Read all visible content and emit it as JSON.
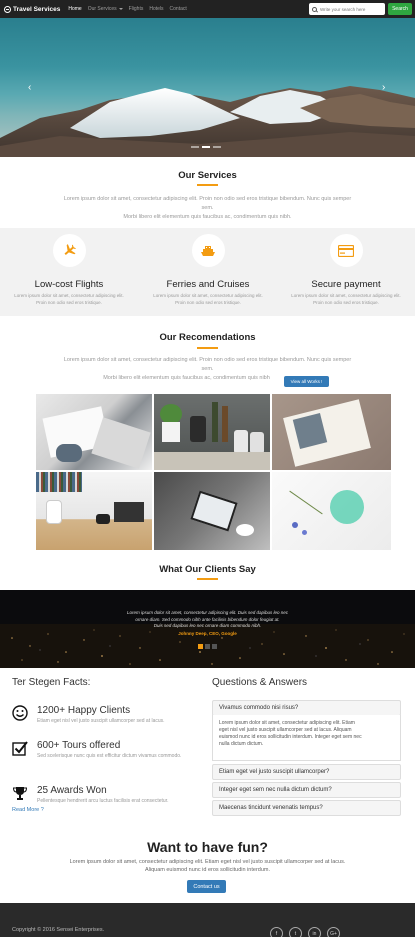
{
  "navbar": {
    "brand": "Travel Services",
    "items": [
      {
        "label": "Home",
        "active": true
      },
      {
        "label": "Our Services",
        "dropdown": true
      },
      {
        "label": "Flights"
      },
      {
        "label": "Hotels"
      },
      {
        "label": "Contact"
      }
    ],
    "search_placeholder": "Write your search here",
    "search_button": "Search"
  },
  "hero": {
    "prev_icon": "chevron-left-icon",
    "next_icon": "chevron-right-icon",
    "slides": 3,
    "active_slide": 2
  },
  "services": {
    "title": "Our Services",
    "text_line1": "Lorem ipsum dolor sit amet, consectetur adipiscing elit. Proin non odio sed eros tristique bibendum. Nunc quis semper",
    "text_line2": "sem.",
    "text_line3": "Morbi libero elit elementum quis faucibus ac, condimentum quis nibh.",
    "features": [
      {
        "icon": "airplane-icon",
        "title": "Low-cost Flights",
        "text1": "Lorem ipsum dolor sit amet, consectetur adipiscing elit.",
        "text2": "Proin non odio sed eros tristique."
      },
      {
        "icon": "ship-icon",
        "title": "Ferries and Cruises",
        "text1": "Lorem ipsum dolor sit amet, consectetur adipiscing elit.",
        "text2": "Proin non odio sed eros tristique."
      },
      {
        "icon": "credit-card-icon",
        "title": "Secure payment",
        "text1": "Lorem ipsum dolor sit amet, consectetur adipiscing elit.",
        "text2": "Proin non odio sed eros tristique."
      }
    ]
  },
  "recommendations": {
    "title": "Our Recomendations",
    "text_line1": "Lorem ipsum dolor sit amet, consectetur adipiscing elit. Proin non odio sed eros tristique bibendum. Nunc quis semper",
    "text_line2": "sem.",
    "text_line3": "Morbi libero elit elementum quis faucibus ac, condimentum quis nibh",
    "button": "View all Works !"
  },
  "clients": {
    "title": "What Our Clients Say",
    "quote_line1": "Lorem ipsum dolor sit amet, consectetur adipiscing elit. Duis sed dapibus leo nec",
    "quote_line2": "ornare diam. Sed commodo nibh ante facilisis bibendum dolor feugiat at.",
    "quote_line3": "Duis sed dapibus leo nec ornare diam commodo nibh.",
    "author": "Johnny Deep, CEO, Google",
    "slides": 3,
    "active_slide": 1
  },
  "facts": {
    "title": "Ter Stegen Facts:",
    "items": [
      {
        "icon": "smiley-icon",
        "title": "1200+ Happy Clients",
        "text": "Etiam eget nisl vel justo suscipit ullamcorper sed at lacus."
      },
      {
        "icon": "checkbox-icon",
        "title": "600+ Tours offered",
        "text": "Sed scelerisque nunc quis est efficitur dictum vivamus commodo."
      },
      {
        "icon": "trophy-icon",
        "title": "25 Awards Won",
        "text": "Pellentesque hendrerit arcu luctus facilisis erat consectetur."
      }
    ],
    "read_more": "Read More ?"
  },
  "qa": {
    "title": "Questions & Answers",
    "items": [
      {
        "question": "Vivamus commodo nisi risus?"
      },
      {
        "question": "Etiam eget vel justo suscipit ullamcorper?"
      },
      {
        "question": "Integer eget sem nec nulla dictum dictum?"
      },
      {
        "question": "Maecenas tincidunt venenatis tempus?"
      }
    ],
    "answer_line1": "Lorem ipsum dolor sit amet, consectetur adipiscing elit. Etiam",
    "answer_line2": "eget nisl vel justo suscipit ullamcorper sed at lacus. Aliquam",
    "answer_line3": "euismod nunc id eros sollicitudin interdum. Integer eget sem nec",
    "answer_line4": "nulla dictum dictum."
  },
  "cta": {
    "title": "Want to have fun?",
    "text_line1": "Lorem ipsum dolor sit amet, consectetur adipiscing elit. Etiam eget nisl vel justo suscipit ullamcorper sed at lacus.",
    "text_line2": "Aliquam euismod nunc id eros sollicitudin interdum.",
    "button": "Contact us"
  },
  "footer": {
    "copyright": "Copyright © 2016 Sensei Enterprises.",
    "socials": [
      {
        "icon": "facebook-icon",
        "glyph": "f"
      },
      {
        "icon": "twitter-icon",
        "glyph": "t"
      },
      {
        "icon": "linkedin-icon",
        "glyph": "in"
      },
      {
        "icon": "google-plus-icon",
        "glyph": "G+"
      }
    ]
  },
  "colors": {
    "accent": "#f39c12",
    "navbar": "#222222",
    "search_button": "#2fa640",
    "primary_button": "#337ab7",
    "footer": "#2a2a2a"
  }
}
